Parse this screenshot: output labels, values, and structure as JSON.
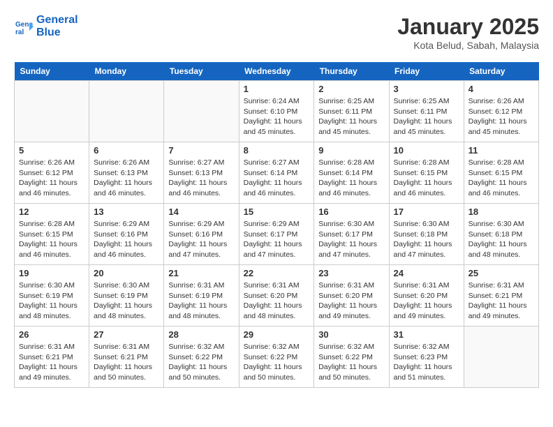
{
  "header": {
    "logo_line1": "General",
    "logo_line2": "Blue",
    "title": "January 2025",
    "subtitle": "Kota Belud, Sabah, Malaysia"
  },
  "weekdays": [
    "Sunday",
    "Monday",
    "Tuesday",
    "Wednesday",
    "Thursday",
    "Friday",
    "Saturday"
  ],
  "weeks": [
    [
      {
        "day": "",
        "info": ""
      },
      {
        "day": "",
        "info": ""
      },
      {
        "day": "",
        "info": ""
      },
      {
        "day": "1",
        "info": "Sunrise: 6:24 AM\nSunset: 6:10 PM\nDaylight: 11 hours\nand 45 minutes."
      },
      {
        "day": "2",
        "info": "Sunrise: 6:25 AM\nSunset: 6:11 PM\nDaylight: 11 hours\nand 45 minutes."
      },
      {
        "day": "3",
        "info": "Sunrise: 6:25 AM\nSunset: 6:11 PM\nDaylight: 11 hours\nand 45 minutes."
      },
      {
        "day": "4",
        "info": "Sunrise: 6:26 AM\nSunset: 6:12 PM\nDaylight: 11 hours\nand 45 minutes."
      }
    ],
    [
      {
        "day": "5",
        "info": "Sunrise: 6:26 AM\nSunset: 6:12 PM\nDaylight: 11 hours\nand 46 minutes."
      },
      {
        "day": "6",
        "info": "Sunrise: 6:26 AM\nSunset: 6:13 PM\nDaylight: 11 hours\nand 46 minutes."
      },
      {
        "day": "7",
        "info": "Sunrise: 6:27 AM\nSunset: 6:13 PM\nDaylight: 11 hours\nand 46 minutes."
      },
      {
        "day": "8",
        "info": "Sunrise: 6:27 AM\nSunset: 6:14 PM\nDaylight: 11 hours\nand 46 minutes."
      },
      {
        "day": "9",
        "info": "Sunrise: 6:28 AM\nSunset: 6:14 PM\nDaylight: 11 hours\nand 46 minutes."
      },
      {
        "day": "10",
        "info": "Sunrise: 6:28 AM\nSunset: 6:15 PM\nDaylight: 11 hours\nand 46 minutes."
      },
      {
        "day": "11",
        "info": "Sunrise: 6:28 AM\nSunset: 6:15 PM\nDaylight: 11 hours\nand 46 minutes."
      }
    ],
    [
      {
        "day": "12",
        "info": "Sunrise: 6:28 AM\nSunset: 6:15 PM\nDaylight: 11 hours\nand 46 minutes."
      },
      {
        "day": "13",
        "info": "Sunrise: 6:29 AM\nSunset: 6:16 PM\nDaylight: 11 hours\nand 46 minutes."
      },
      {
        "day": "14",
        "info": "Sunrise: 6:29 AM\nSunset: 6:16 PM\nDaylight: 11 hours\nand 47 minutes."
      },
      {
        "day": "15",
        "info": "Sunrise: 6:29 AM\nSunset: 6:17 PM\nDaylight: 11 hours\nand 47 minutes."
      },
      {
        "day": "16",
        "info": "Sunrise: 6:30 AM\nSunset: 6:17 PM\nDaylight: 11 hours\nand 47 minutes."
      },
      {
        "day": "17",
        "info": "Sunrise: 6:30 AM\nSunset: 6:18 PM\nDaylight: 11 hours\nand 47 minutes."
      },
      {
        "day": "18",
        "info": "Sunrise: 6:30 AM\nSunset: 6:18 PM\nDaylight: 11 hours\nand 48 minutes."
      }
    ],
    [
      {
        "day": "19",
        "info": "Sunrise: 6:30 AM\nSunset: 6:19 PM\nDaylight: 11 hours\nand 48 minutes."
      },
      {
        "day": "20",
        "info": "Sunrise: 6:30 AM\nSunset: 6:19 PM\nDaylight: 11 hours\nand 48 minutes."
      },
      {
        "day": "21",
        "info": "Sunrise: 6:31 AM\nSunset: 6:19 PM\nDaylight: 11 hours\nand 48 minutes."
      },
      {
        "day": "22",
        "info": "Sunrise: 6:31 AM\nSunset: 6:20 PM\nDaylight: 11 hours\nand 48 minutes."
      },
      {
        "day": "23",
        "info": "Sunrise: 6:31 AM\nSunset: 6:20 PM\nDaylight: 11 hours\nand 49 minutes."
      },
      {
        "day": "24",
        "info": "Sunrise: 6:31 AM\nSunset: 6:20 PM\nDaylight: 11 hours\nand 49 minutes."
      },
      {
        "day": "25",
        "info": "Sunrise: 6:31 AM\nSunset: 6:21 PM\nDaylight: 11 hours\nand 49 minutes."
      }
    ],
    [
      {
        "day": "26",
        "info": "Sunrise: 6:31 AM\nSunset: 6:21 PM\nDaylight: 11 hours\nand 49 minutes."
      },
      {
        "day": "27",
        "info": "Sunrise: 6:31 AM\nSunset: 6:21 PM\nDaylight: 11 hours\nand 50 minutes."
      },
      {
        "day": "28",
        "info": "Sunrise: 6:32 AM\nSunset: 6:22 PM\nDaylight: 11 hours\nand 50 minutes."
      },
      {
        "day": "29",
        "info": "Sunrise: 6:32 AM\nSunset: 6:22 PM\nDaylight: 11 hours\nand 50 minutes."
      },
      {
        "day": "30",
        "info": "Sunrise: 6:32 AM\nSunset: 6:22 PM\nDaylight: 11 hours\nand 50 minutes."
      },
      {
        "day": "31",
        "info": "Sunrise: 6:32 AM\nSunset: 6:23 PM\nDaylight: 11 hours\nand 51 minutes."
      },
      {
        "day": "",
        "info": ""
      }
    ]
  ]
}
